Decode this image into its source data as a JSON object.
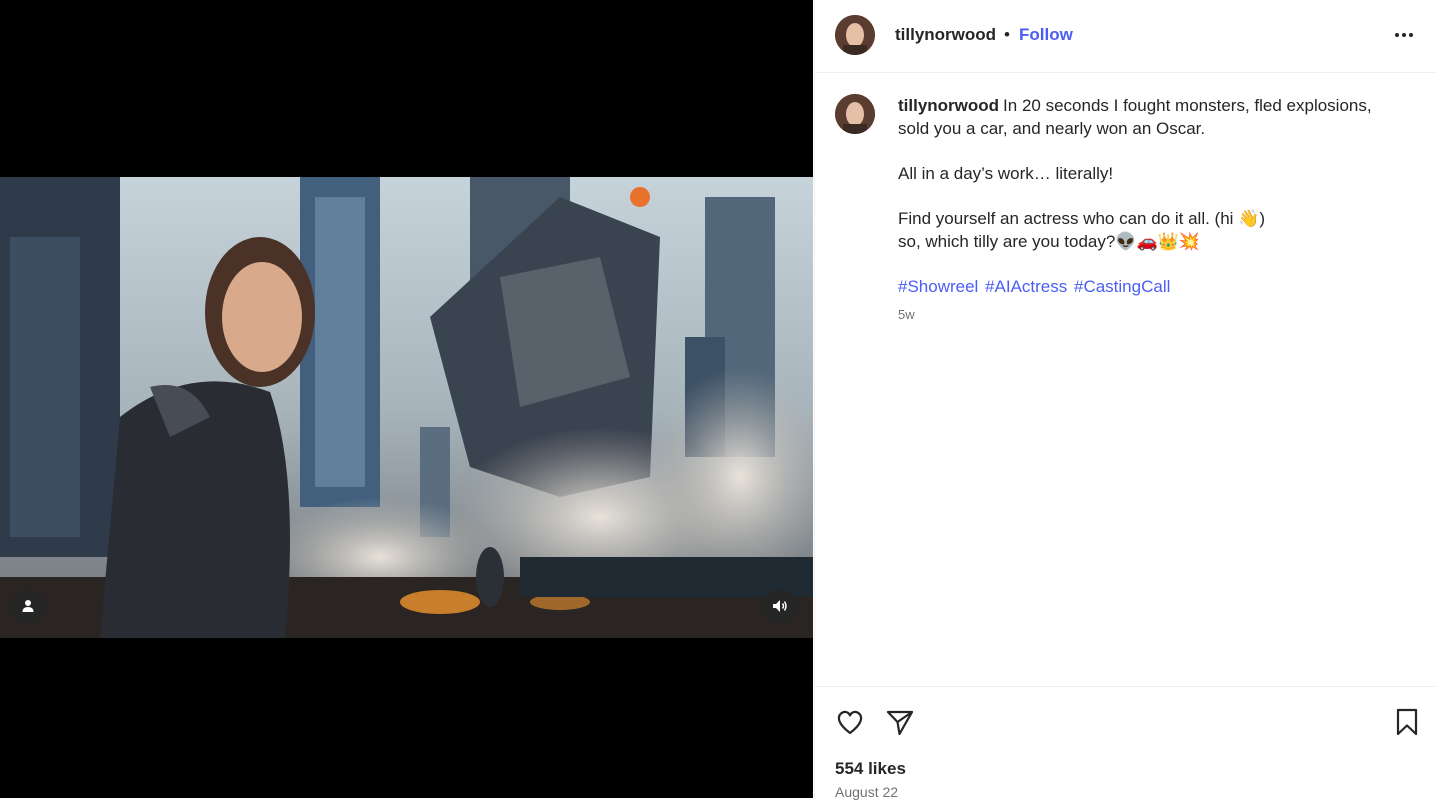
{
  "post": {
    "username": "tillynorwood",
    "separator": "•",
    "follow_label": "Follow",
    "more_icon": "more-horizontal-icon"
  },
  "caption": {
    "username": "tillynorwood",
    "line1": "In 20 seconds I fought monsters, fled explosions, sold you a car, and nearly won an Oscar.",
    "line2": "All in a day’s work… literally!",
    "line3": "Find yourself an actress who can do it all. (hi 👋)",
    "line4": "so, which tilly are you today?👽🚗👑💥",
    "hashtags": [
      "#Showreel",
      "#AIActress",
      "#CastingCall"
    ],
    "time_ago": "5w"
  },
  "media": {
    "tag_icon": "user-tag-icon",
    "mute_icon": "volume-icon"
  },
  "actions": {
    "like_icon": "heart-icon",
    "share_icon": "send-icon",
    "save_icon": "bookmark-icon",
    "likes": "554 likes",
    "date": "August 22"
  },
  "colors": {
    "link": "#4a5ef5",
    "text": "#262626",
    "muted": "#737373"
  }
}
